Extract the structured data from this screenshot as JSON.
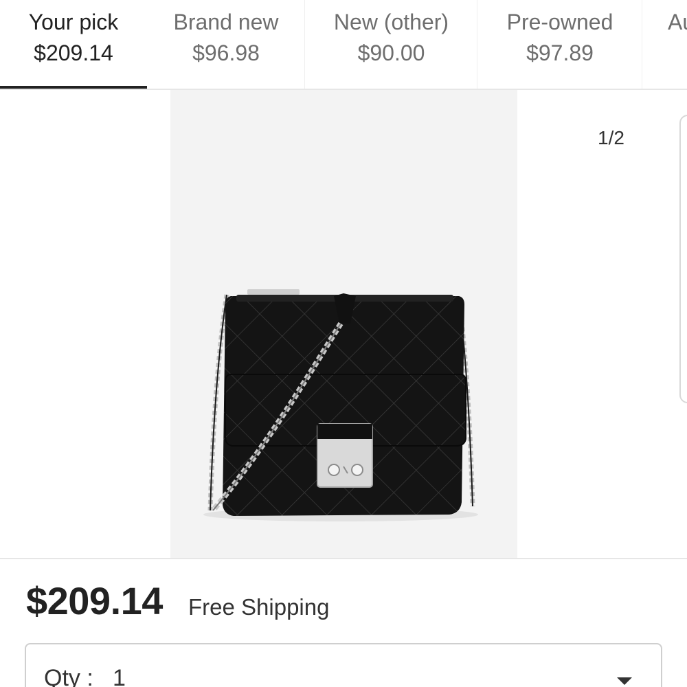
{
  "tabs": [
    {
      "label": "Your pick",
      "price": "$209.14"
    },
    {
      "label": "Brand new",
      "price": "$96.98"
    },
    {
      "label": "New (other)",
      "price": "$90.00"
    },
    {
      "label": "Pre-owned",
      "price": "$97.89"
    },
    {
      "label": "Au",
      "price": ""
    }
  ],
  "gallery": {
    "counter": "1/2",
    "image_alt": "Black quilted crossbody bag with silver chain strap and silver lock clasp"
  },
  "listing": {
    "price": "$209.14",
    "shipping": "Free Shipping"
  },
  "quantity": {
    "label": "Qty :",
    "value": "1"
  },
  "colors": {
    "tab_active": "#222222",
    "tab_inactive": "#6e6e6e",
    "image_bg": "#f3f3f3",
    "divider": "#e6e6e6"
  }
}
